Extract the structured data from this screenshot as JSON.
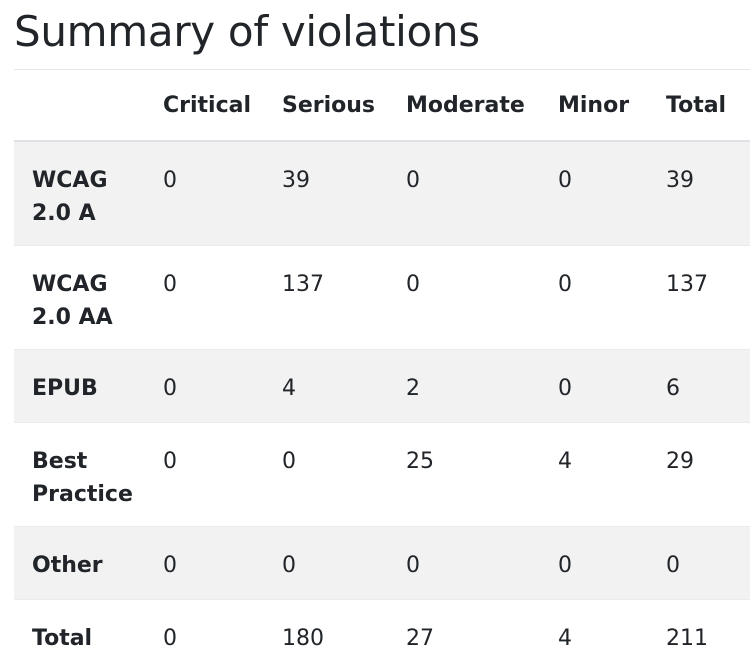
{
  "page": {
    "title": "Summary of violations"
  },
  "table": {
    "headers": [
      "",
      "Critical",
      "Serious",
      "Moderate",
      "Minor",
      "Total"
    ],
    "rows": [
      {
        "label": "WCAG 2.0 A",
        "critical": "0",
        "serious": "39",
        "moderate": "0",
        "minor": "0",
        "total": "39"
      },
      {
        "label": "WCAG 2.0 AA",
        "critical": "0",
        "serious": "137",
        "moderate": "0",
        "minor": "0",
        "total": "137"
      },
      {
        "label": "EPUB",
        "critical": "0",
        "serious": "4",
        "moderate": "2",
        "minor": "0",
        "total": "6"
      },
      {
        "label": "Best Practice",
        "critical": "0",
        "serious": "0",
        "moderate": "25",
        "minor": "4",
        "total": "29"
      },
      {
        "label": "Other",
        "critical": "0",
        "serious": "0",
        "moderate": "0",
        "minor": "0",
        "total": "0"
      },
      {
        "label": "Total",
        "critical": "0",
        "serious": "180",
        "moderate": "27",
        "minor": "4",
        "total": "211"
      }
    ]
  }
}
